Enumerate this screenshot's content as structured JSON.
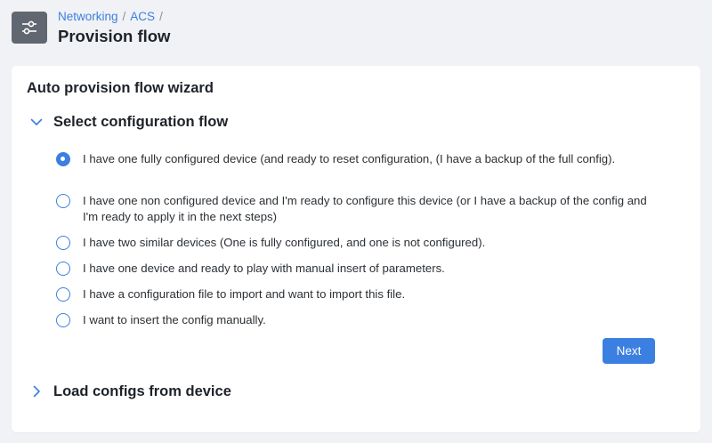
{
  "header": {
    "icon": "sliders-icon",
    "breadcrumb": [
      "Networking",
      "ACS"
    ],
    "separator": "/",
    "title": "Provision flow"
  },
  "card": {
    "title": "Auto provision flow wizard",
    "sections": [
      {
        "title": "Select configuration flow",
        "expanded": true,
        "icon": "chevron-down-icon"
      },
      {
        "title": "Load configs from device",
        "expanded": false,
        "icon": "chevron-right-icon"
      }
    ],
    "options": [
      {
        "label": "I have one fully configured device (and ready to reset configuration, (I have a backup of the full config).",
        "checked": true
      },
      {
        "label": "I have one non configured device and I'm ready to configure this device (or I have a backup of the config and I'm ready to apply it in the next steps)",
        "checked": false
      },
      {
        "label": "I have two similar devices (One is fully configured, and one is not configured).",
        "checked": false
      },
      {
        "label": "I have one device and ready to play with manual insert of parameters.",
        "checked": false
      },
      {
        "label": "I have a configuration file to import and want to import this file.",
        "checked": false
      },
      {
        "label": "I want to insert the config manually.",
        "checked": false
      }
    ],
    "next_label": "Next"
  },
  "colors": {
    "accent": "#3b7fe0",
    "background": "#f1f2f5",
    "header_icon_bg": "#606770"
  }
}
